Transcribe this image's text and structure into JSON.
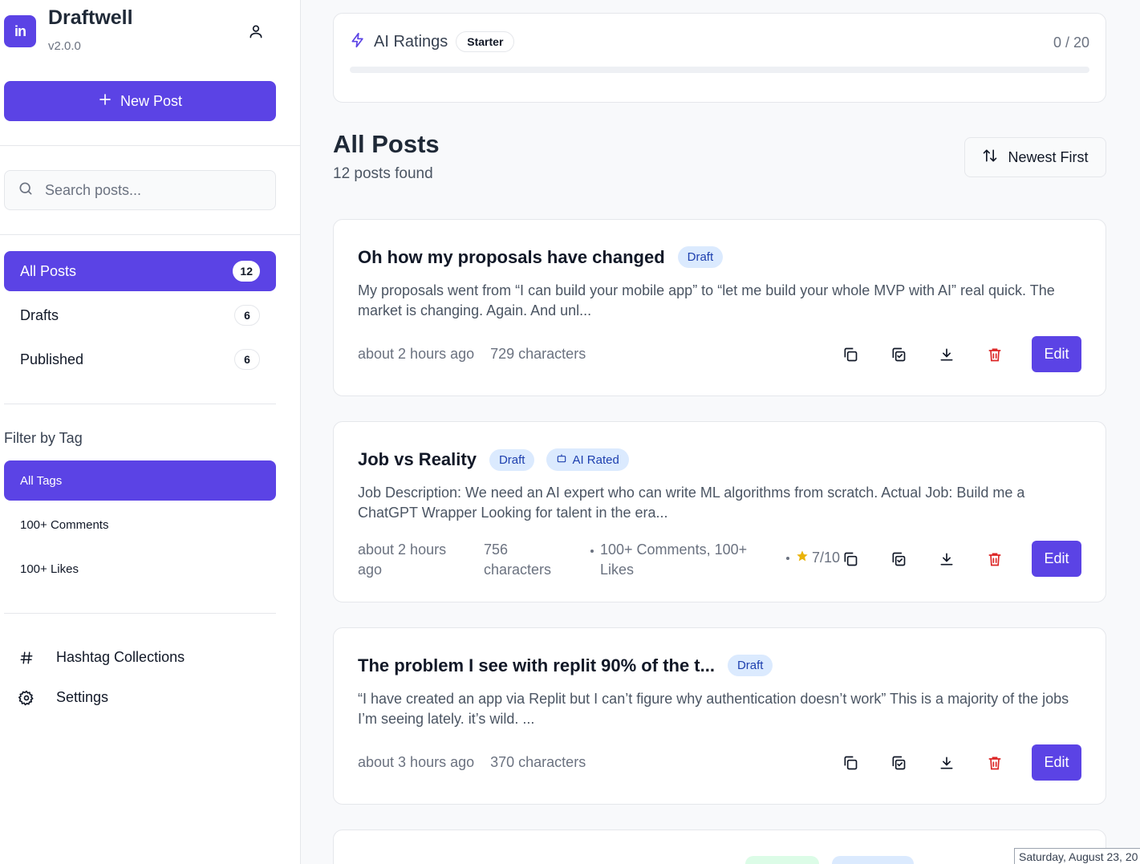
{
  "app": {
    "name": "Draftwell",
    "version": "v2.0.0",
    "logo_text": "in"
  },
  "sidebar": {
    "new_post_label": "New Post",
    "search_placeholder": "Search posts...",
    "nav": [
      {
        "label": "All Posts",
        "count": "12"
      },
      {
        "label": "Drafts",
        "count": "6"
      },
      {
        "label": "Published",
        "count": "6"
      }
    ],
    "filter_title": "Filter by Tag",
    "tags": [
      "All Tags",
      "100+ Comments",
      "100+ Likes"
    ],
    "links": [
      "Hashtag Collections",
      "Settings"
    ]
  },
  "ratings": {
    "label": "AI Ratings",
    "plan": "Starter",
    "used": "0 / 20",
    "progress_fraction": 0
  },
  "main": {
    "title": "All Posts",
    "subtitle": "12 posts found",
    "sort_label": "Newest First"
  },
  "posts": [
    {
      "title": "Oh how my proposals have changed",
      "status": "Draft",
      "excerpt": "My proposals went from “I can build your mobile app” to “let me build your whole MVP with AI” real quick. The market is changing. Again. And unl...",
      "time": "about 2 hours ago",
      "chars": "729 characters"
    },
    {
      "title": "Job vs Reality",
      "status": "Draft",
      "ai_badge": "AI Rated",
      "excerpt": "Job Description: We need an AI expert who can write ML algorithms from scratch. Actual Job: Build me a ChatGPT Wrapper Looking for talent in the era...",
      "time": "about 2 hours ago",
      "chars": "756 characters",
      "tags": "100+ Comments, 100+ Likes",
      "rating": "7/10"
    },
    {
      "title": "The problem I see with replit 90% of the t...",
      "status": "Draft",
      "excerpt": "“I have created an app via Replit but I can’t figure why authentication doesn’t work” This is a majority of the jobs I’m seeing lately. it’s wild. ...",
      "time": "about 3 hours ago",
      "chars": "370 characters"
    }
  ],
  "actions": {
    "edit_label": "Edit"
  },
  "tooltip": {
    "date": "Saturday, August 23, 20"
  },
  "colors": {
    "accent": "#5b43e5",
    "delete": "#dc2626",
    "draft_bg": "#dbeafe",
    "draft_text": "#1e40af",
    "star": "#eab308"
  }
}
